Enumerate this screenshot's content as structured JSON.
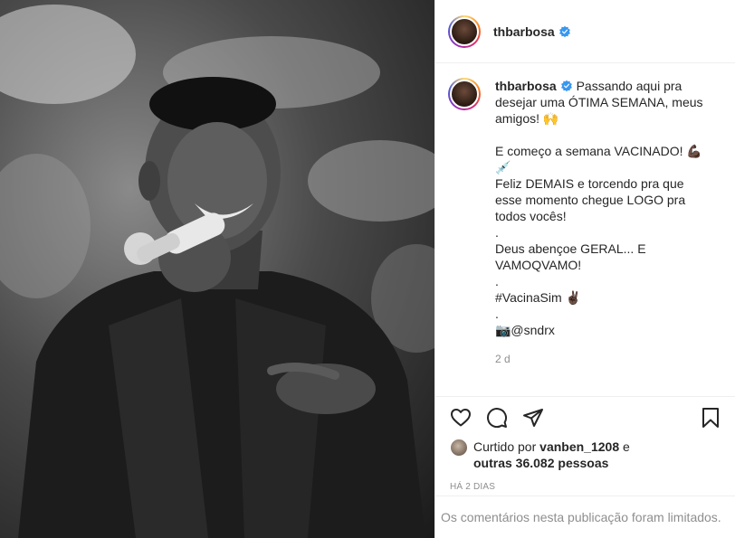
{
  "post": {
    "username": "thbarbosa",
    "caption": {
      "username": "thbarbosa",
      "lines1": [
        "Passando aqui pra",
        "desejar uma ÓTIMA SEMANA, meus",
        "amigos! 🙌"
      ],
      "lines2": [
        "E começo a semana VACINADO! 💪🏿",
        "💉",
        "Feliz DEMAIS e torcendo pra que",
        "esse momento chegue LOGO pra",
        "todos vocês!",
        "."
      ],
      "lines3": [
        "Deus abençoe GERAL... E",
        "VAMOQVAMO!",
        "."
      ],
      "hashtag": "#VacinaSim ✌🏿",
      "dot": ".",
      "credit": "📷@sndrx"
    },
    "timestamp": "2 d",
    "likes": {
      "prefix": "Curtido por",
      "user": "vanben_1208",
      "connector": "e",
      "others": "outras 36.082 pessoas"
    },
    "date": "HÁ 2 DIAS",
    "comments_limited": "Os comentários nesta publicação foram limitados.",
    "icons": [
      "heart-icon",
      "comment-icon",
      "share-icon",
      "bookmark-icon",
      "verified-badge-icon"
    ],
    "colors": {
      "verified": "#3897f0",
      "muted": "#8e8e8e",
      "text": "#262626"
    }
  }
}
